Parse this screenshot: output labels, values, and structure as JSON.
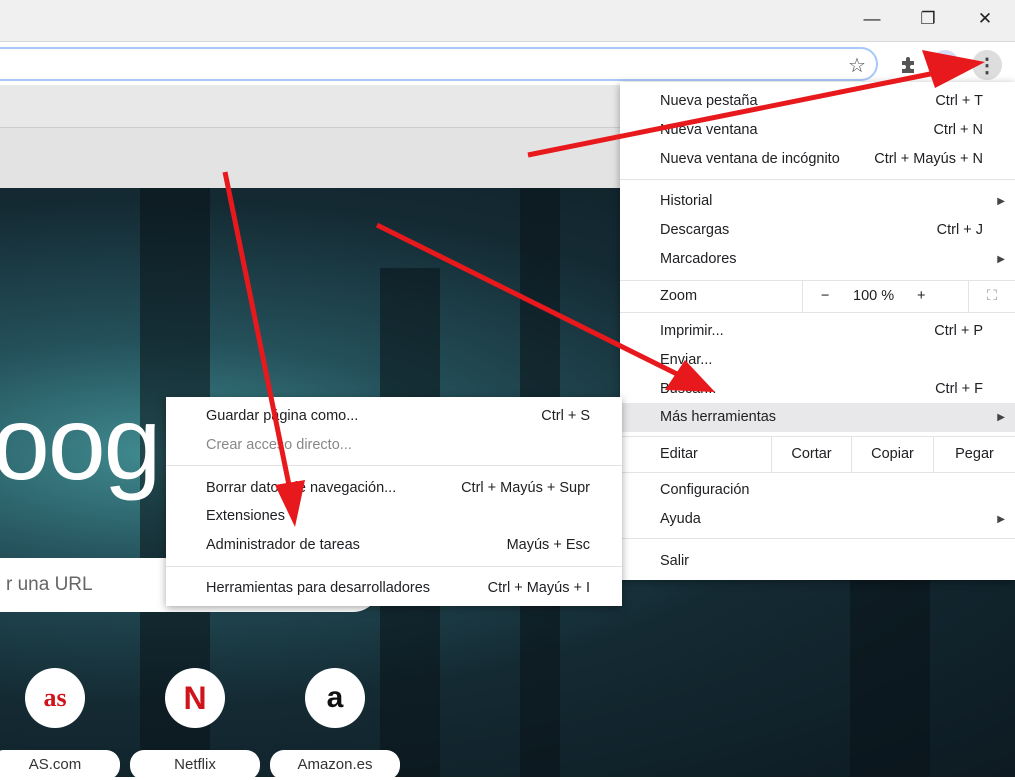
{
  "window": {
    "minimize": "—",
    "restore": "❐",
    "close": "✕"
  },
  "toolbar": {
    "star": "☆",
    "menu": "⋮"
  },
  "page": {
    "logo": "oogl",
    "search_placeholder": "r una URL",
    "shortcuts": [
      {
        "label": "AS.com",
        "icon": "as"
      },
      {
        "label": "Netflix",
        "icon": "N"
      },
      {
        "label": "Amazon.es",
        "icon": "a"
      }
    ]
  },
  "menu": {
    "new_tab": {
      "label": "Nueva pestaña",
      "shortcut": "Ctrl + T"
    },
    "new_window": {
      "label": "Nueva ventana",
      "shortcut": "Ctrl + N"
    },
    "incognito": {
      "label": "Nueva ventana de incógnito",
      "shortcut": "Ctrl + Mayús + N"
    },
    "history": {
      "label": "Historial"
    },
    "downloads": {
      "label": "Descargas",
      "shortcut": "Ctrl + J"
    },
    "bookmarks": {
      "label": "Marcadores"
    },
    "zoom": {
      "label": "Zoom",
      "minus": "−",
      "value": "100 %",
      "plus": "+"
    },
    "print": {
      "label": "Imprimir...",
      "shortcut": "Ctrl + P"
    },
    "cast": {
      "label": "Enviar..."
    },
    "find": {
      "label": "Buscar...",
      "shortcut": "Ctrl + F"
    },
    "more_tools": {
      "label": "Más herramientas"
    },
    "edit": {
      "label": "Editar",
      "cut": "Cortar",
      "copy": "Copiar",
      "paste": "Pegar"
    },
    "settings": {
      "label": "Configuración"
    },
    "help": {
      "label": "Ayuda"
    },
    "exit": {
      "label": "Salir"
    }
  },
  "submenu": {
    "save": {
      "label": "Guardar página como...",
      "shortcut": "Ctrl + S"
    },
    "shortcut": {
      "label": "Crear acceso directo..."
    },
    "clear": {
      "label": "Borrar datos de navegación...",
      "shortcut": "Ctrl + Mayús + Supr"
    },
    "extensions": {
      "label": "Extensiones"
    },
    "task_manager": {
      "label": "Administrador de tareas",
      "shortcut": "Mayús + Esc"
    },
    "devtools": {
      "label": "Herramientas para desarrolladores",
      "shortcut": "Ctrl + Mayús + I"
    }
  },
  "colors": {
    "arrow": "#e8191c",
    "highlight": "#e8e8ea"
  }
}
